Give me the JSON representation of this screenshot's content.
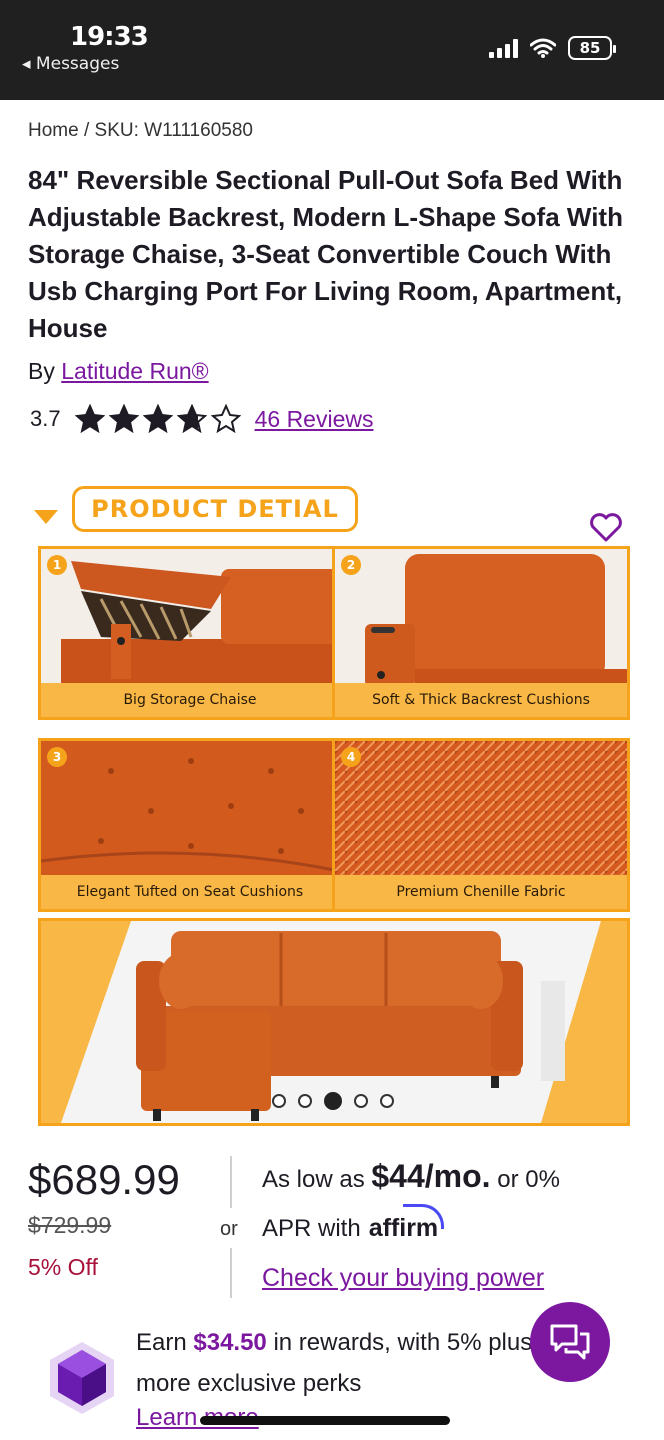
{
  "status_bar": {
    "time": "19:33",
    "back_label": "◂ Messages",
    "battery": "85"
  },
  "breadcrumb": {
    "home": "Home",
    "separator": "/",
    "sku": "SKU: W111160580"
  },
  "product": {
    "title": "84\" Reversible Sectional Pull-Out Sofa Bed With Adjustable Backrest, Modern L-Shape Sofa With Storage Chaise, 3-Seat Convertible Couch With Usb Charging Port For Living Room, Apartment, House",
    "by_label": "By",
    "brand": "Latitude Run®",
    "rating": "3.7",
    "rating_value": 3.7,
    "reviews_label": "46 Reviews"
  },
  "gallery": {
    "badge": "PRODUCT DETIAL",
    "tiles": [
      {
        "number": "1",
        "caption": "Big Storage Chaise"
      },
      {
        "number": "2",
        "caption": "Soft & Thick Backrest Cushions"
      },
      {
        "number": "3",
        "caption": "Elegant Tufted on Seat Cushions"
      },
      {
        "number": "4",
        "caption": "Premium Chenille Fabric"
      }
    ],
    "dot_count": 5,
    "active_dot": 3
  },
  "pricing": {
    "price": "$689.99",
    "was_price": "$729.99",
    "discount": "5% Off",
    "or_label": "or",
    "as_low_as": "As low as",
    "monthly": "$44/mo.",
    "or_zero": "or 0%",
    "apr": "APR with",
    "affirm": "affirm",
    "buying_power": "Check your buying power"
  },
  "rewards": {
    "earn": "Earn",
    "amount": "$34.50",
    "rest": "in rewards, with 5% plus more exclusive perks",
    "learn_more": "Learn more"
  },
  "colors": {
    "brand_purple": "#7b189f",
    "accent_orange": "#f5a31a",
    "sofa_orange": "#d25a1c",
    "sale_red": "#a8123a"
  },
  "icons": [
    "chevron-left-icon",
    "signal-icon",
    "wifi-icon",
    "battery-icon",
    "star-icon",
    "heart-icon",
    "caret-down-icon",
    "gem-icon",
    "chat-icon"
  ]
}
